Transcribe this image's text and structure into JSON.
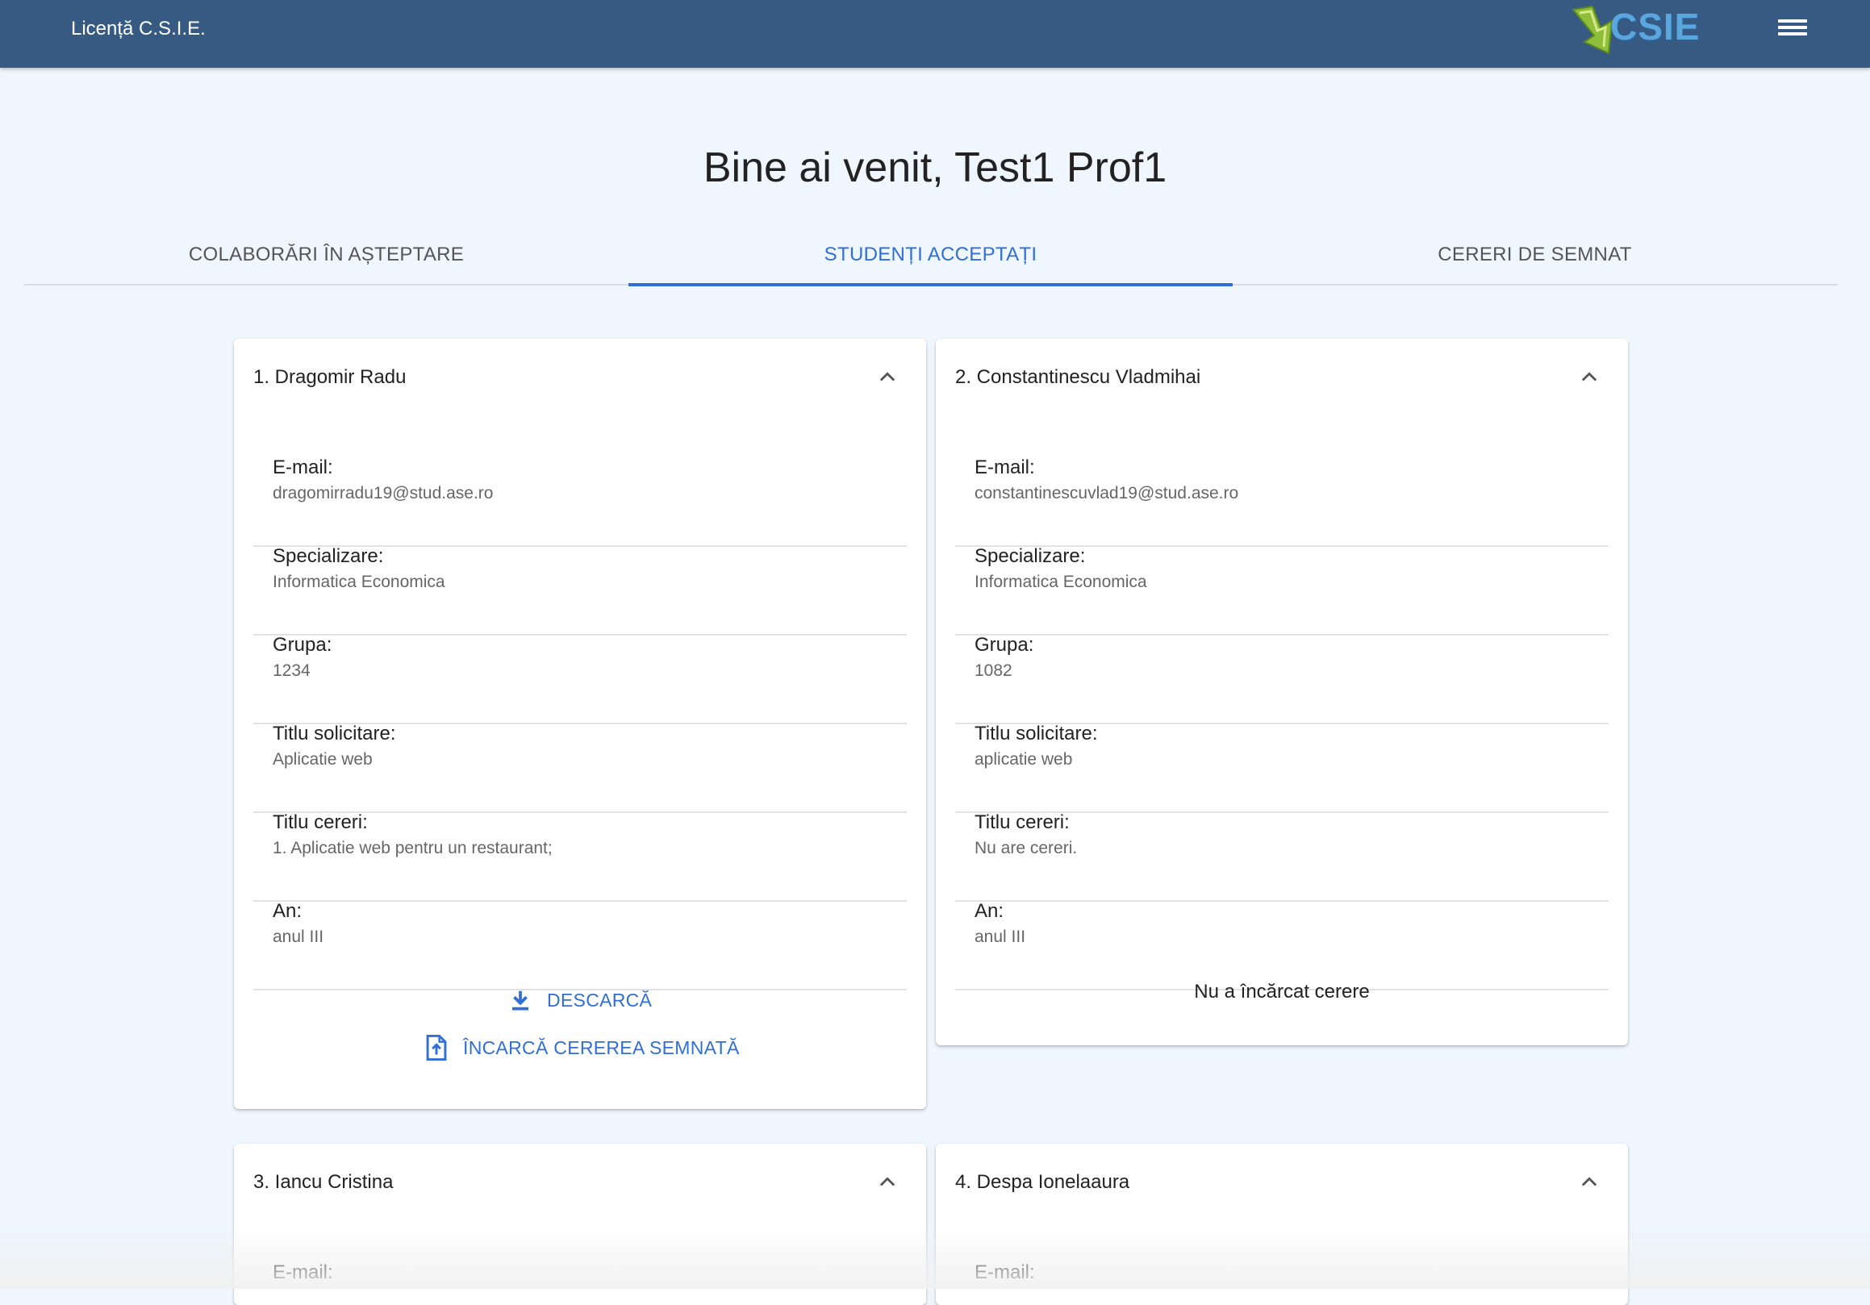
{
  "header": {
    "app_title": "Licență C.S.I.E.",
    "logo_text": "CSIE",
    "menu_icon": "hamburger-menu-icon"
  },
  "welcome": "Bine ai venit, Test1 Prof1",
  "tabs": [
    {
      "label": "COLABORĂRI ÎN AȘTEPTARE"
    },
    {
      "label": "STUDENȚI ACCEPTAȚI"
    },
    {
      "label": "CERERI DE SEMNAT"
    }
  ],
  "active_tab": "STUDENȚI ACCEPTAȚI",
  "colors": {
    "header": "#375a82",
    "accent": "#2f6fd6",
    "background": "#eff6fd"
  },
  "labels": {
    "email": "E-mail:",
    "spec": "Specializare:",
    "grupa": "Grupa:",
    "titlu_solicitare": "Titlu solicitare:",
    "titlu_cereri": "Titlu cereri:",
    "an": "An:"
  },
  "students": [
    {
      "title": "1. Dragomir Radu",
      "email": "dragomirradu19@stud.ase.ro",
      "spec": "Informatica Economica",
      "grupa": "1234",
      "titlu_solicitare": "Aplicatie web",
      "titlu_cereri": "1. Aplicatie web pentru un restaurant;",
      "an": "anul III",
      "download_label": "DESCARCĂ",
      "upload_label": "ÎNCARCĂ CEREREA SEMNATĂ"
    },
    {
      "title": "2. Constantinescu Vladmihai",
      "email": "constantinescuvlad19@stud.ase.ro",
      "spec": "Informatica Economica",
      "grupa": "1082",
      "titlu_solicitare": "aplicatie web",
      "titlu_cereri": "Nu are cereri.",
      "an": "anul III",
      "no_request": "Nu a încărcat cerere"
    },
    {
      "title": "3. Iancu Cristina"
    },
    {
      "title": "4. Despa Ionelaaura"
    }
  ]
}
